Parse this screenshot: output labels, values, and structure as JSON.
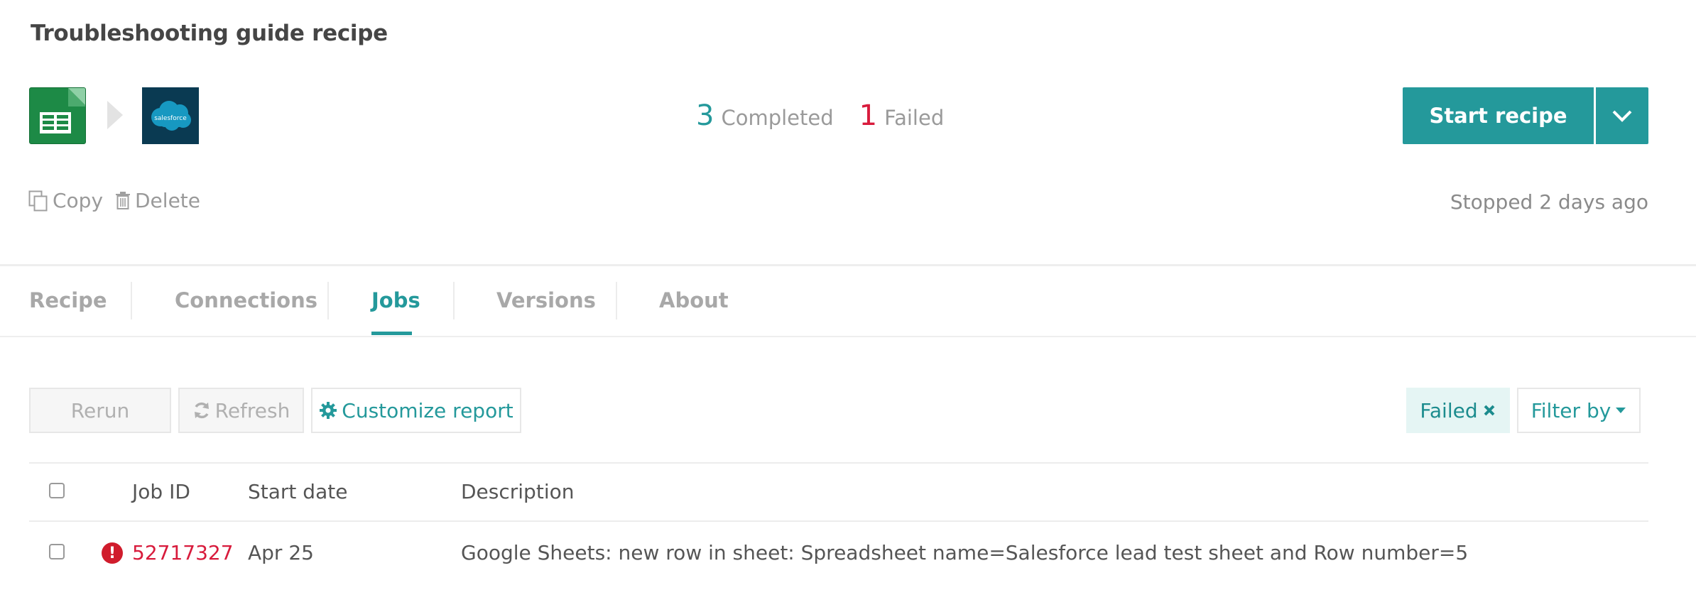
{
  "header": {
    "title": "Troubleshooting guide recipe",
    "source_app_icon": "google-sheets-icon",
    "target_app_icon": "salesforce-icon",
    "target_app_logo_text": "salesforce"
  },
  "stats": {
    "completed_count": "3",
    "completed_label": "Completed",
    "failed_count": "1",
    "failed_label": "Failed"
  },
  "actions": {
    "start_label": "Start recipe",
    "copy_label": "Copy",
    "delete_label": "Delete",
    "status": "Stopped 2 days ago"
  },
  "tabs": [
    {
      "label": "Recipe"
    },
    {
      "label": "Connections"
    },
    {
      "label": "Jobs"
    },
    {
      "label": "Versions"
    },
    {
      "label": "About"
    }
  ],
  "active_tab": "Jobs",
  "toolbar": {
    "rerun_label": "Rerun",
    "refresh_label": "Refresh",
    "customize_label": "Customize report",
    "filter_chip_label": "Failed",
    "filter_by_label": "Filter by"
  },
  "table": {
    "headers": [
      "Job ID",
      "Start date",
      "Description"
    ],
    "rows": [
      {
        "status": "failed",
        "job_id": "52717327",
        "start_date": "Apr 25",
        "description": "Google Sheets: new row in sheet: Spreadsheet name=Salesforce lead test sheet and Row number=5"
      }
    ]
  },
  "colors": {
    "accent": "#24999b",
    "error": "#d81b3c",
    "sheets_green": "#1d8a46",
    "salesforce_bg": "#0a3a52",
    "salesforce_cloud": "#1798c1"
  }
}
